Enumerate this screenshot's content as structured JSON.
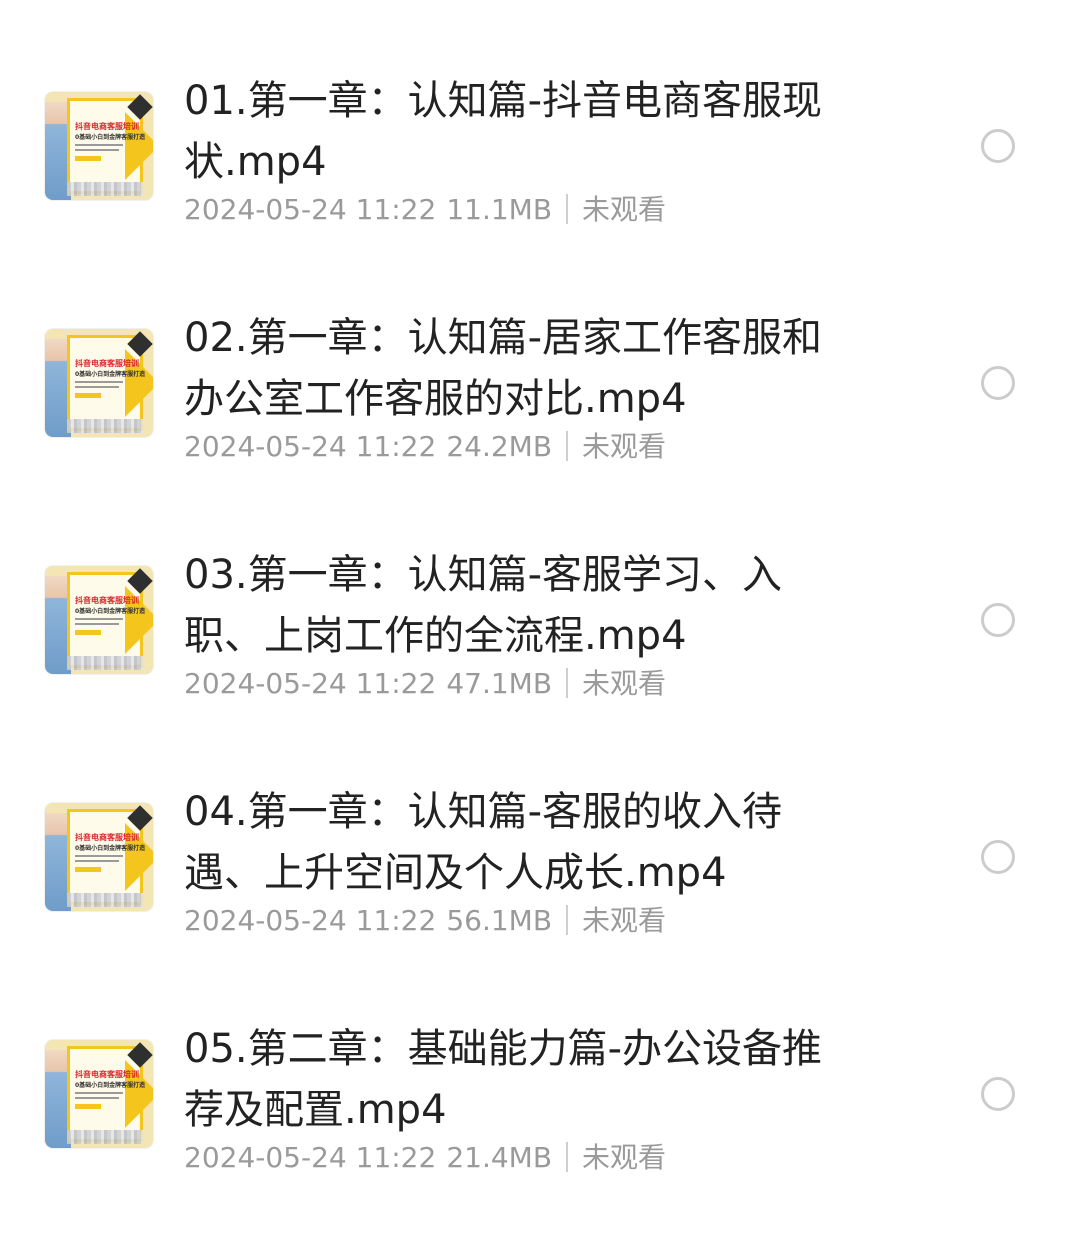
{
  "files": [
    {
      "name": "01.第一章：认知篇-抖音电商客服现状.mp4",
      "date": "2024-05-24 11:22",
      "size": "11.1MB",
      "status": "未观看",
      "thumbnail": {
        "title": "抖音电商客服培训",
        "subtitle": "0基础小白到金牌客服打造"
      }
    },
    {
      "name": "02.第一章：认知篇-居家工作客服和办公室工作客服的对比.mp4",
      "date": "2024-05-24 11:22",
      "size": "24.2MB",
      "status": "未观看",
      "thumbnail": {
        "title": "抖音电商客服培训",
        "subtitle": "0基础小白到金牌客服打造"
      }
    },
    {
      "name": "03.第一章：认知篇-客服学习、入职、上岗工作的全流程.mp4",
      "date": "2024-05-24 11:22",
      "size": "47.1MB",
      "status": "未观看",
      "thumbnail": {
        "title": "抖音电商客服培训",
        "subtitle": "0基础小白到金牌客服打造"
      }
    },
    {
      "name": "04.第一章：认知篇-客服的收入待遇、上升空间及个人成长.mp4",
      "date": "2024-05-24 11:22",
      "size": "56.1MB",
      "status": "未观看",
      "thumbnail": {
        "title": "抖音电商客服培训",
        "subtitle": "0基础小白到金牌客服打造"
      }
    },
    {
      "name": "05.第二章：基础能力篇-办公设备推荐及配置.mp4",
      "date": "2024-05-24 11:22",
      "size": "21.4MB",
      "status": "未观看",
      "thumbnail": {
        "title": "抖音电商客服培训",
        "subtitle": "0基础小白到金牌客服打造"
      }
    }
  ],
  "colors": {
    "name_text": "#222222",
    "meta_text": "#9a9a9a",
    "radio_border": "#cccccc",
    "thumb_accent": "#f4c51c",
    "thumb_title": "#d7262b"
  },
  "icons": {
    "select": "radio-unchecked-icon",
    "thumbnail": "video-thumbnail"
  }
}
